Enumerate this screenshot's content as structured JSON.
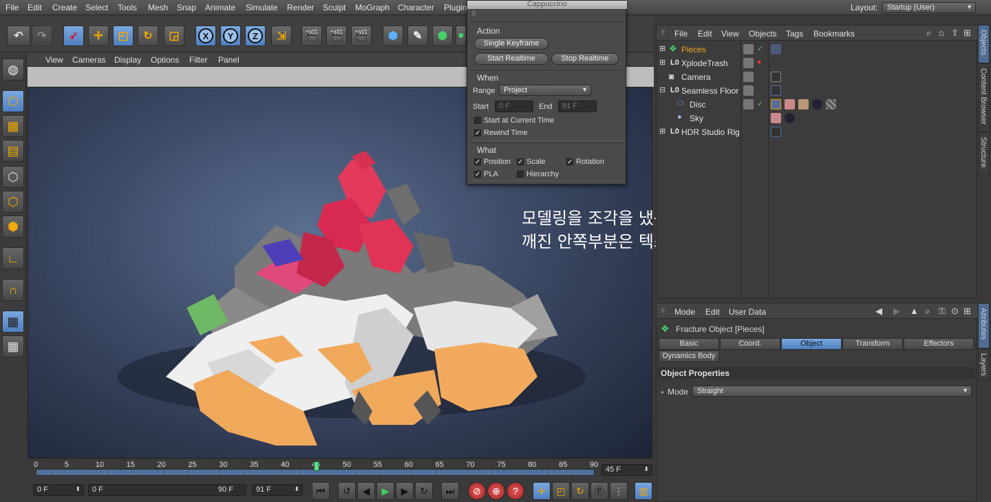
{
  "menubar": {
    "items": [
      "File",
      "Edit",
      "Create",
      "Select",
      "Tools",
      "Mesh",
      "Snap",
      "Animate",
      "Simulate",
      "Render",
      "Sculpt",
      "MoGraph",
      "Character",
      "Plugin"
    ],
    "layout_label": "Layout:",
    "layout_value": "Startup (User)"
  },
  "toolbar": {
    "x_label": "X",
    "y_label": "Y",
    "z_label": "Z"
  },
  "viewport": {
    "menu": [
      "View",
      "Cameras",
      "Display",
      "Options",
      "Filter",
      "Panel"
    ],
    "note_line1": "모델링을 조각을 냈는데,",
    "note_line2": "깨진 안쪽부분은 텍스쳐가 안들어갑니다 ㅠㅠ"
  },
  "popup": {
    "title": "Cappuccino",
    "action_label": "Action",
    "single_keyframe": "Single Keyframe",
    "start_realtime": "Start Realtime",
    "stop_realtime": "Stop Realtime",
    "when_label": "When",
    "range_label": "Range",
    "range_value": "Project",
    "start_label": "Start",
    "start_value": "0 F",
    "end_label": "End",
    "end_value": "91 F",
    "start_at_current": "Start at Current Time",
    "start_at_current_checked": false,
    "rewind_time": "Rewind Time",
    "rewind_time_checked": true,
    "what_label": "What",
    "position": "Position",
    "scale": "Scale",
    "rotation": "Rotation",
    "pla": "PLA",
    "hierarchy": "Hierarchy"
  },
  "objects": {
    "menu": [
      "File",
      "Edit",
      "View",
      "Objects",
      "Tags",
      "Bookmarks"
    ],
    "rows": [
      {
        "name": "Pieces",
        "selected": true,
        "indent": 0
      },
      {
        "name": "XplodeTrash",
        "selected": false,
        "indent": 0
      },
      {
        "name": "Camera",
        "selected": false,
        "indent": 0
      },
      {
        "name": "Seamless Floor",
        "selected": false,
        "indent": 0
      },
      {
        "name": "Disc",
        "selected": false,
        "indent": 1
      },
      {
        "name": "Sky",
        "selected": false,
        "indent": 1
      },
      {
        "name": "HDR Studio Rig",
        "selected": false,
        "indent": 0
      }
    ]
  },
  "side_tabs": {
    "objects": "Objects",
    "content_browser": "Content Browser",
    "structure": "Structure",
    "attributes": "Attributes",
    "layers": "Layers"
  },
  "attributes": {
    "menu": [
      "Mode",
      "Edit",
      "User Data"
    ],
    "object_title": "Fracture Object [Pieces]",
    "tabs": [
      "Basic",
      "Coord.",
      "Object",
      "Transform",
      "Effectors"
    ],
    "active_tab": "Object",
    "tab_row2": "Dynamics Body",
    "section": "Object Properties",
    "mode_label": "Mode",
    "mode_value": "Straight"
  },
  "timeline": {
    "ticks": [
      "0",
      "5",
      "10",
      "15",
      "20",
      "25",
      "30",
      "35",
      "40",
      "45",
      "50",
      "55",
      "60",
      "65",
      "70",
      "75",
      "80",
      "85",
      "90"
    ],
    "current_frame": "45 F",
    "playhead_frame": 45,
    "max_frame": 90
  },
  "transport": {
    "start_field": "0 F",
    "range_start": "0 F",
    "range_end": "90 F",
    "end_field": "91 F"
  }
}
